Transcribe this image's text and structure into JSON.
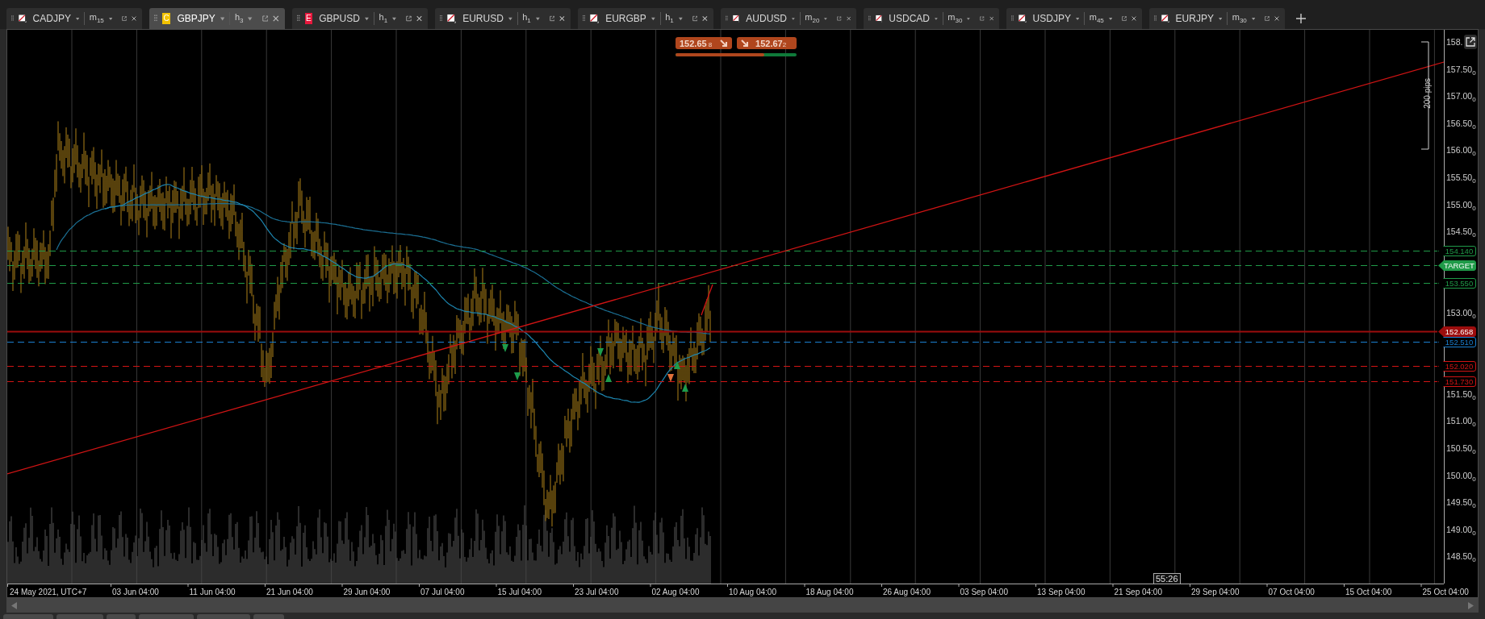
{
  "tabs": [
    {
      "symbol": "CADJPY",
      "icon": {
        "kind": "slash"
      },
      "timeframe": "m$_{15}$",
      "selected": false
    },
    {
      "symbol": "GBPJPY",
      "icon": {
        "kind": "letter",
        "letter": "C",
        "color": "#f2c200"
      },
      "timeframe": "h$_{3}$",
      "selected": true
    },
    {
      "symbol": "GBPUSD",
      "icon": {
        "kind": "letter",
        "letter": "E",
        "color": "#e8173c"
      },
      "timeframe": "h$_{1}$",
      "selected": false
    },
    {
      "symbol": "EURUSD",
      "icon": {
        "kind": "slash"
      },
      "timeframe": "h$_{1}$",
      "selected": false
    },
    {
      "symbol": "EURGBP",
      "icon": {
        "kind": "slash"
      },
      "timeframe": "h$_{1}$",
      "selected": false
    },
    {
      "symbol": "AUDUSD",
      "icon": {
        "kind": "slash"
      },
      "timeframe": "m$_{20}$",
      "selected": false
    },
    {
      "symbol": "USDCAD",
      "icon": {
        "kind": "slash"
      },
      "timeframe": "m$_{30}$",
      "selected": false
    },
    {
      "symbol": "USDJPY",
      "icon": {
        "kind": "slash"
      },
      "timeframe": "m$_{45}$",
      "selected": false
    },
    {
      "symbol": "EURJPY",
      "icon": {
        "kind": "slash"
      },
      "timeframe": "m$_{30}$",
      "selected": false
    }
  ],
  "quote": {
    "bid": {
      "price": "152.65",
      "pipette": "8"
    },
    "ask": {
      "price": "152.67",
      "pipette": "2"
    },
    "sentiment": {
      "level": 0.73
    }
  },
  "price_axis": {
    "labels": [
      "158.",
      "157.50$_{0}$",
      "157.00$_{0}$",
      "156.50$_{0}$",
      "156.00$_{0}$",
      "155.50$_{0}$",
      "155.00$_{0}$",
      "154.50$_{0}$",
      "153.00$_{0}$",
      "151.50$_{0}$",
      "151.00$_{0}$",
      "150.50$_{0}$",
      "150.00$_{0}$",
      "149.50$_{0}$",
      "149.00$_{0}$",
      "148.50$_{0}$"
    ]
  },
  "pip_ruler": {
    "label": "200 pips"
  },
  "price_lines": [
    {
      "label": "154.140",
      "kind": "outline",
      "color": "#1f9a48"
    },
    {
      "label": "TARGET",
      "kind": "filled",
      "color": "#1f9a48"
    },
    {
      "label": "153.550",
      "kind": "outline",
      "color": "#1f9a48"
    },
    {
      "label": "152.658",
      "kind": "current",
      "color": "#9c0d0d"
    },
    {
      "label": "152.510",
      "kind": "outline",
      "color": "#1a7fd0"
    },
    {
      "label": "152.020",
      "kind": "outline",
      "color": "#d21414"
    },
    {
      "label": "151.730",
      "kind": "outline",
      "color": "#d21414"
    }
  ],
  "time_axis": {
    "labels": [
      "24 May 2021, UTC+7",
      "03 Jun 04:00",
      "11 Jun 04:00",
      "21 Jun 04:00",
      "29 Jun 04:00",
      "07 Jul 04:00",
      "15 Jul 04:00",
      "23 Jul 04:00",
      "02 Aug 04:00",
      "10 Aug 04:00",
      "18 Aug 04:00",
      "26 Aug 04:00",
      "03 Sep 04:00",
      "13 Sep 04:00",
      "21 Sep 04:00",
      "29 Sep 04:00",
      "07 Oct 04:00",
      "15 Oct 04:00",
      "25 Oct 04:00"
    ]
  },
  "countdown": "55:26"
}
